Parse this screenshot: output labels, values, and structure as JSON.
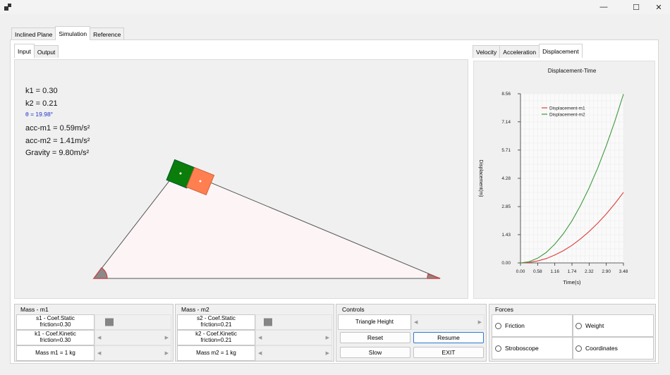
{
  "main_tabs": [
    "Inclined Plane",
    "Simulation",
    "Reference"
  ],
  "sub_tabs": [
    "Input",
    "Output"
  ],
  "chart_tabs": [
    "Velocity",
    "Acceleration",
    "Displacement"
  ],
  "window": {
    "minimize": "—",
    "maximize": "☐",
    "close": "✕"
  },
  "readouts": {
    "k1": "k1 = 0.30",
    "k2": "k2 = 0.21",
    "theta": "θ = 19.98°",
    "acc_m1": "acc-m1  = 0.59m/s²",
    "acc_m2": "acc-m2  = 1.41m/s²",
    "gravity": "Gravity = 9.80m/s²"
  },
  "colors": {
    "block_m1": "#0a7d0a",
    "block_m2": "#ff7f50",
    "angle": "#c0504d",
    "series_m1": "#e03c3c",
    "series_m2": "#3e9a3e"
  },
  "chart_data": {
    "type": "line",
    "title": "Displacement-Time",
    "xlabel": "Time(s)",
    "ylabel": "Displacement(m)",
    "xlim": [
      0,
      3.48
    ],
    "ylim": [
      0,
      8.56
    ],
    "xticks": [
      "0.00",
      "0.58",
      "1.16",
      "1.74",
      "2.32",
      "2.90",
      "3.48"
    ],
    "yticks": [
      "0.00",
      "1.43",
      "2.85",
      "4.28",
      "5.71",
      "7.14",
      "8.56"
    ],
    "x": [
      0,
      0.29,
      0.58,
      0.87,
      1.16,
      1.45,
      1.74,
      2.03,
      2.32,
      2.61,
      2.9,
      3.19,
      3.48
    ],
    "series": [
      {
        "name": "Displacement-m1",
        "values": [
          0,
          0.02,
          0.1,
          0.22,
          0.4,
          0.62,
          0.89,
          1.22,
          1.59,
          2.01,
          2.48,
          3.0,
          3.57
        ]
      },
      {
        "name": "Displacement-m2",
        "values": [
          0,
          0.06,
          0.24,
          0.53,
          0.95,
          1.48,
          2.13,
          2.91,
          3.8,
          4.8,
          5.93,
          7.17,
          8.54
        ]
      }
    ],
    "grid": true,
    "legend": "top-left"
  },
  "mass_m1": {
    "title": "Mass - m1",
    "static_label": "s1 - Coef.Static\nfriction=0.30",
    "kinetic_label": "k1 - Coef.Kinetic\nfriction=0.30",
    "mass_label": "Mass m1 = 1 kg",
    "static_slider_level": 0.15
  },
  "mass_m2": {
    "title": "Mass - m2",
    "static_label": "s2 - Coef.Static\nfriction=0.21",
    "kinetic_label": "k2 - Coef.Kinetic\nfriction=0.21",
    "mass_label": "Mass m2 = 1 kg",
    "static_slider_level": 0.12
  },
  "controls": {
    "title": "Controls",
    "triangle_height": "Triangle Height",
    "reset": "Reset",
    "resume": "Resume",
    "slow": "Slow",
    "exit": "EXIT"
  },
  "forces": {
    "title": "Forces",
    "friction": "Friction",
    "weight": "Weight",
    "stroboscope": "Stroboscope",
    "coordinates": "Coordinates"
  }
}
